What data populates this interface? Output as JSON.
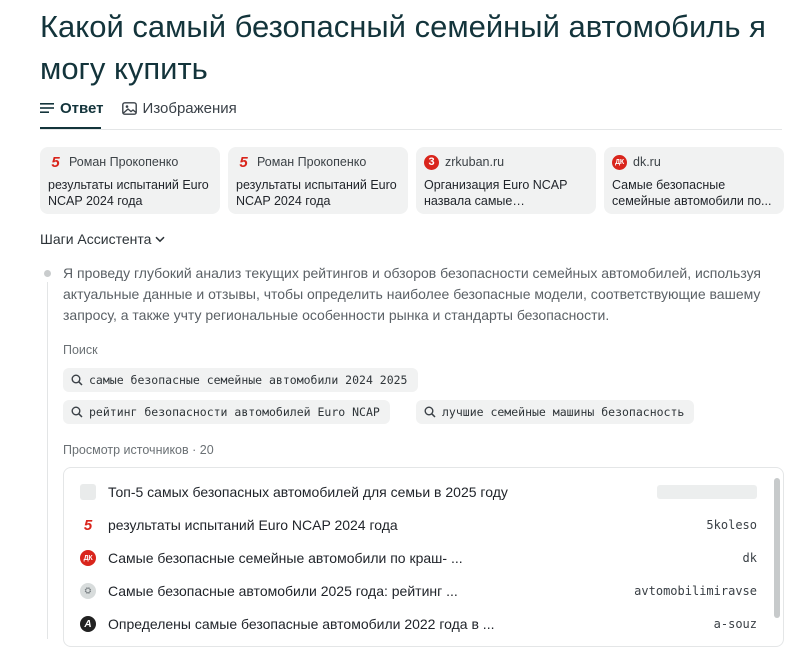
{
  "page": {
    "title": "Какой самый безопасный семейный автомобиль я могу купить"
  },
  "tabs": [
    {
      "label": "Ответ",
      "icon": "answer-lines-icon",
      "active": true
    },
    {
      "label": "Изображения",
      "icon": "image-icon",
      "active": false
    }
  ],
  "source_cards": [
    {
      "favicon": "5",
      "source": "Роман Прокопенко",
      "text": "результаты испытаний Euro NCAP 2024 года"
    },
    {
      "favicon": "5",
      "source": "Роман Прокопенко",
      "text": "результаты испытаний Euro NCAP 2024 года"
    },
    {
      "favicon": "3",
      "source": "zrkuban.ru",
      "text": "Организация Euro NCAP назвала самые безопасные..."
    },
    {
      "favicon": "ДК",
      "source": "dk.ru",
      "text": "Самые безопасные семейные автомобили по..."
    }
  ],
  "assistant": {
    "steps_label": "Шаги Ассистента",
    "step_text": "Я проведу глубокий анализ текущих рейтингов и обзоров безопасности семейных автомобилей, используя актуальные данные и отзывы, чтобы определить наиболее безопасные модели, соответствующие вашему запросу, а также учту региональные особенности рынка и стандарты безопасности.",
    "search_label": "Поиск",
    "search_queries": [
      "самые безопасные семейные автомобили 2024 2025",
      "рейтинг безопасности автомобилей Euro NCAP",
      "лучшие семейные машины безопасность"
    ],
    "sources_label": "Просмотр источников · 20",
    "sources": [
      {
        "favicon": "",
        "title": "Топ-5 самых безопасных автомобилей для семьи в 2025 году",
        "domain": ""
      },
      {
        "favicon": "5",
        "title": "результаты испытаний Euro NCAP 2024 года",
        "domain": "5koleso"
      },
      {
        "favicon": "ДК",
        "title": "Самые безопасные семейные автомобили по краш- ...",
        "domain": "dk"
      },
      {
        "favicon": "",
        "title": "Самые безопасные автомобили 2025 года: рейтинг ...",
        "domain": "avtomobilimiravse"
      },
      {
        "favicon": "A",
        "title": "Определены самые безопасные автомобили 2022 года в ...",
        "domain": "a-souz"
      }
    ]
  },
  "colors": {
    "title": "#13343b",
    "favicon_red": "#d9251c",
    "card_bg": "#f1f2f2"
  }
}
